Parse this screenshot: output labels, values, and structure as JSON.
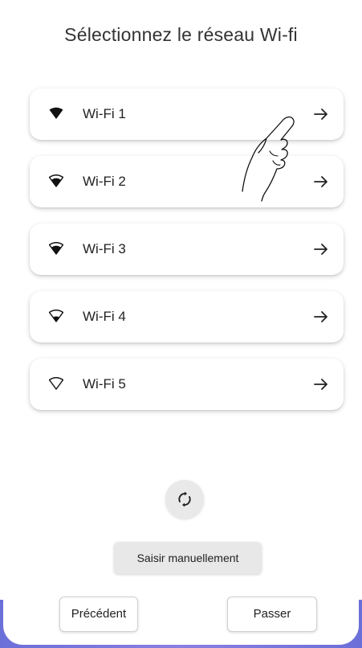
{
  "title": "Sélectionnez le réseau Wi-fi",
  "networks": [
    {
      "name": "Wi-Fi 1",
      "signal": 4
    },
    {
      "name": "Wi-Fi 2",
      "signal": 3
    },
    {
      "name": "Wi-Fi 3",
      "signal": 3
    },
    {
      "name": "Wi-Fi 4",
      "signal": 2
    },
    {
      "name": "Wi-Fi 5",
      "signal": 0
    }
  ],
  "buttons": {
    "manual": "Saisir manuellement",
    "previous": "Précédent",
    "skip": "Passer"
  },
  "icons": {
    "wifi": "wifi-signal-icon",
    "arrow": "arrow-right-icon",
    "refresh": "refresh-icon",
    "hand": "pointing-hand-icon"
  },
  "colors": {
    "accent": "#6b6fd8",
    "text": "#222222",
    "button_gray": "#e8e8e8"
  }
}
